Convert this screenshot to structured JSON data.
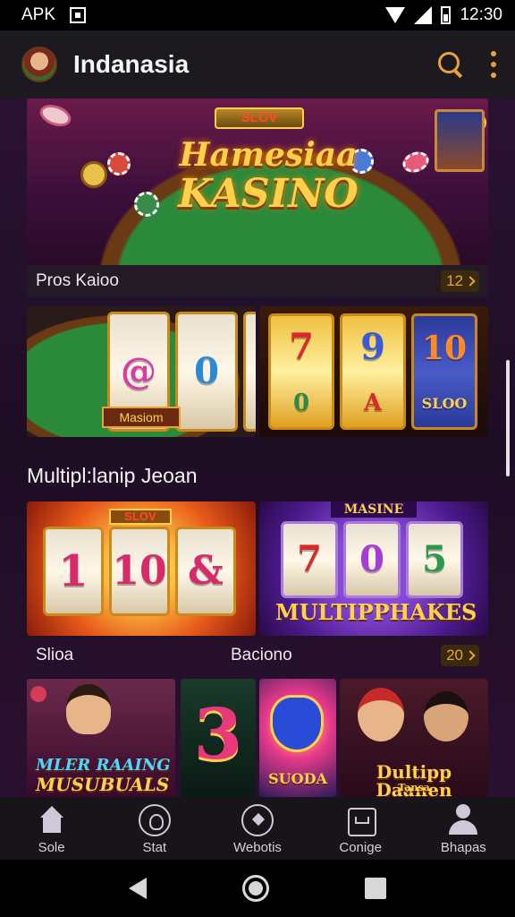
{
  "status_bar": {
    "carrier": "APK",
    "time": "12:30"
  },
  "app_bar": {
    "title": "Indanasia"
  },
  "hero": {
    "sign": "SLOV",
    "title_line1": "Hamesiaa",
    "title_line2": "KASINO",
    "caption": "Pros Kaioo",
    "badge": "12"
  },
  "row1": {
    "tile1_plate": "Masiom",
    "tile1_symbols": [
      "@",
      "0",
      "&"
    ],
    "tile2_symbols": [
      "7",
      "9",
      "10"
    ],
    "tile2_bottom": [
      "0",
      "A",
      "SLOO"
    ]
  },
  "section": {
    "title": "Multipl:lanip Jeoan"
  },
  "row2": {
    "tile1_sign": "SLOV",
    "tile1_symbols": [
      "1",
      "10",
      "&"
    ],
    "tile2_sign": "MASINE",
    "tile2_symbols": [
      "7",
      "0",
      "5"
    ],
    "tile2_caption": "MULTIPPHAKES",
    "label_left": "Slioa",
    "label_right": "Baciono",
    "badge": "20"
  },
  "row3": {
    "tile1_text_l1": "MLER RAAING",
    "tile1_text_l2": "MUSUBUALS",
    "tile2_symbol": "3",
    "tile3_text": "SUODA",
    "tile4_text_l1": "Dultipp Daanen",
    "tile4_text_l2": "Tansa"
  },
  "bottom_nav": {
    "items": [
      {
        "label": "Sole",
        "icon": "home-icon"
      },
      {
        "label": "Stat",
        "icon": "profile-circle-icon"
      },
      {
        "label": "Webotis",
        "icon": "sparkle-circle-icon"
      },
      {
        "label": "Conige",
        "icon": "wallet-icon"
      },
      {
        "label": "Bhapas",
        "icon": "person-icon"
      }
    ]
  }
}
